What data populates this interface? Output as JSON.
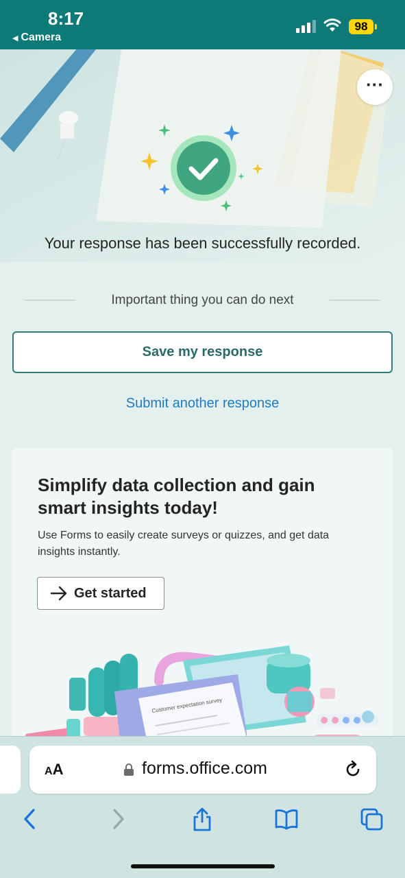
{
  "status_bar": {
    "time": "8:17",
    "back_label": "Camera",
    "battery": "98",
    "colors": {
      "background": "#0d7a78",
      "battery": "#ffd60a"
    }
  },
  "form": {
    "more_options_icon": "more-horizontal-icon",
    "success_icon": "checkmark-circle-icon",
    "success_message": "Your response has been successfully recorded.",
    "next_section_label": "Important thing you can do next",
    "save_button_label": "Save my response",
    "submit_another_label": "Submit another response",
    "accent_color": "#2f7c79",
    "link_color": "#1f7bbf"
  },
  "promo": {
    "title": "Simplify data collection and gain smart insights today!",
    "body": "Use Forms to easily create surveys or quizzes, and get data insights instantly.",
    "cta_label": "Get started",
    "cta_icon": "arrow-right-icon",
    "illustration_text": "Customer expectation survey"
  },
  "browser": {
    "text_size_label_small": "A",
    "text_size_label_large": "A",
    "url": "forms.office.com",
    "lock_icon": "lock-icon",
    "reload_icon": "reload-icon",
    "toolbar": [
      {
        "name": "back",
        "icon": "chevron-left-icon"
      },
      {
        "name": "forward",
        "icon": "chevron-right-icon"
      },
      {
        "name": "share",
        "icon": "share-icon"
      },
      {
        "name": "bookmarks",
        "icon": "book-icon"
      },
      {
        "name": "tabs",
        "icon": "tabs-icon"
      }
    ]
  }
}
